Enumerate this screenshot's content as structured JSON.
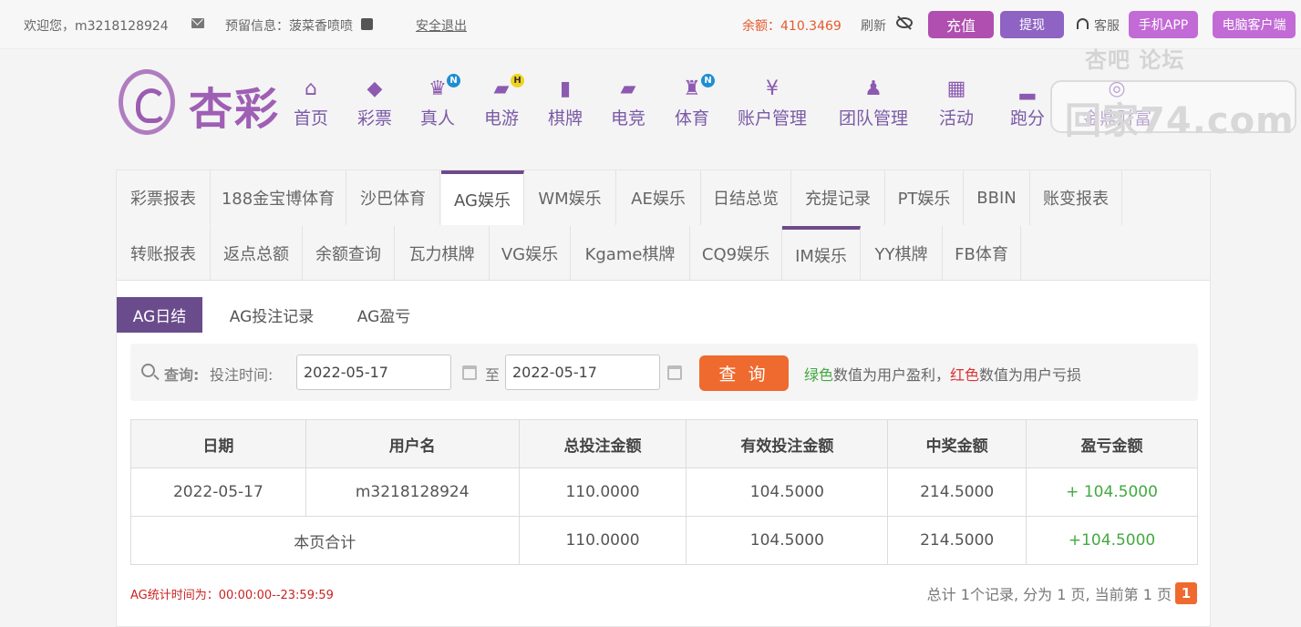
{
  "topbar": {
    "welcome": "欢迎您，m3218128924",
    "reserved_info": "预留信息：菠菜香喷喷",
    "logout": "安全退出",
    "balance": "余额：410.3469",
    "refresh": "刷新",
    "recharge": "充值",
    "withdraw": "提现",
    "service": "客服",
    "mobile_app": "手机APP",
    "pc_client": "电脑客户端"
  },
  "logo": {
    "text": "杏彩"
  },
  "nav": [
    {
      "label": "首页",
      "icon": "home-icon",
      "glyph": "⌂"
    },
    {
      "label": "彩票",
      "icon": "lottery-ticket-icon",
      "glyph": "◆"
    },
    {
      "label": "真人",
      "icon": "live-dealer-icon",
      "glyph": "♛",
      "badge": "N"
    },
    {
      "label": "电游",
      "icon": "gamepad-icon",
      "glyph": "▰",
      "badge": "H"
    },
    {
      "label": "棋牌",
      "icon": "cards-icon",
      "glyph": "▮"
    },
    {
      "label": "电竞",
      "icon": "esports-gamepad-icon",
      "glyph": "▰"
    },
    {
      "label": "体育",
      "icon": "trophy-icon",
      "glyph": "♜",
      "badge": "N"
    },
    {
      "label": "账户管理",
      "icon": "yen-coin-icon",
      "glyph": "¥"
    },
    {
      "label": "团队管理",
      "icon": "team-icon",
      "glyph": "♟"
    },
    {
      "label": "活动",
      "icon": "gift-icon",
      "glyph": "▦"
    },
    {
      "label": "跑分",
      "icon": "running-icon",
      "glyph": "▂"
    },
    {
      "label": "金鼎财富",
      "icon": "wealth-icon",
      "glyph": "◎"
    }
  ],
  "watermark": {
    "top": "杏吧  论坛",
    "main": "回家74.com"
  },
  "report_tabs_row1": [
    "彩票报表",
    "188金宝博体育",
    "沙巴体育",
    "AG娱乐",
    "WM娱乐",
    "AE娱乐",
    "日结总览",
    "充提记录",
    "PT娱乐",
    "BBIN",
    "账变报表"
  ],
  "report_tabs_row2": [
    "转账报表",
    "返点总额",
    "余额查询",
    "瓦力棋牌",
    "VG娱乐",
    "Kgame棋牌",
    "CQ9娱乐",
    "IM娱乐",
    "YY棋牌",
    "FB体育"
  ],
  "active_tab": "AG娱乐",
  "subtabs": [
    "AG日结",
    "AG投注记录",
    "AG盈亏"
  ],
  "active_subtab": "AG日结",
  "query": {
    "search_label": "查询:",
    "time_label": "投注时间:",
    "start_date": "2022-05-17",
    "to": "至",
    "end_date": "2022-05-17",
    "button": "查 询",
    "note_green": "绿色",
    "note_mid": "数值为用户盈利，",
    "note_red": "红色",
    "note_end": "数值为用户亏损"
  },
  "table": {
    "headers": [
      "日期",
      "用户名",
      "总投注金额",
      "有效投注金额",
      "中奖金额",
      "盈亏金额"
    ],
    "row": [
      "2022-05-17",
      "m3218128924",
      "110.0000",
      "104.5000",
      "214.5000",
      "+ 104.5000"
    ],
    "total_label": "本页合计",
    "total": [
      "110.0000",
      "104.5000",
      "214.5000",
      "+104.5000"
    ]
  },
  "footer": {
    "stat_note": "AG统计时间为：00:00:00--23:59:59",
    "pager_text": "总计 1个记录, 分为 1 页, 当前第 1 页",
    "current_page": "1"
  },
  "colors": {
    "accent": "#6e4a8c",
    "button_orange": "#ef6a2e",
    "profit_green": "#43a940",
    "loss_red": "#d33333",
    "balance_orange": "#e45a2c"
  }
}
